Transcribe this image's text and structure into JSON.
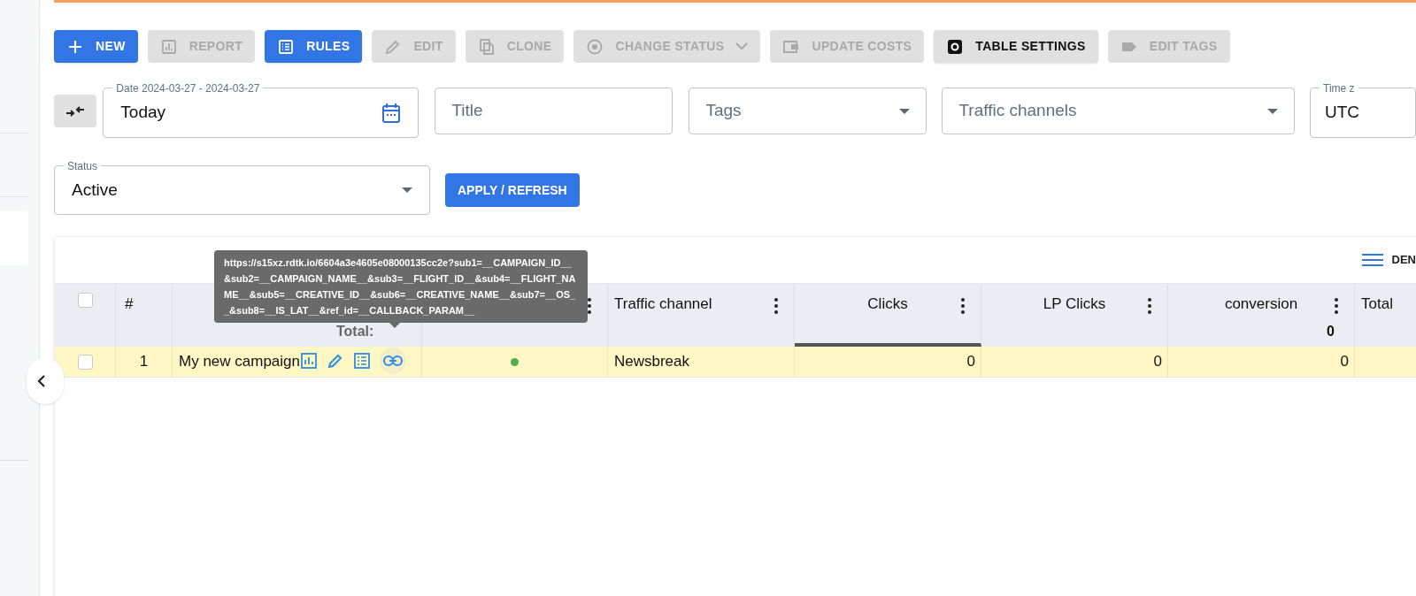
{
  "toolbar": [
    {
      "label": "NEW",
      "kind": "primary",
      "disabled": false
    },
    {
      "label": "REPORT",
      "kind": "default",
      "disabled": true
    },
    {
      "label": "RULES",
      "kind": "primary",
      "disabled": false
    },
    {
      "label": "EDIT",
      "kind": "default",
      "disabled": true
    },
    {
      "label": "CLONE",
      "kind": "default",
      "disabled": true
    },
    {
      "label": "CHANGE STATUS",
      "kind": "dropdown",
      "disabled": true
    },
    {
      "label": "UPDATE COSTS",
      "kind": "default",
      "disabled": true
    },
    {
      "label": "TABLE SETTINGS",
      "kind": "default",
      "disabled": false
    },
    {
      "label": "EDIT TAGS",
      "kind": "default",
      "disabled": true
    }
  ],
  "filters": {
    "date": {
      "label": "Date 2024-03-27 - 2024-03-27",
      "value": "Today"
    },
    "title": {
      "placeholder": "Title"
    },
    "tags": {
      "placeholder": "Tags"
    },
    "traffic_channels": {
      "placeholder": "Traffic channels"
    },
    "time_zone": {
      "label": "Time z",
      "value": "UTC"
    },
    "status": {
      "label": "Status",
      "value": "Active"
    },
    "apply_button": "APPLY / REFRESH"
  },
  "density_button": "DEN",
  "table": {
    "all_checked": false,
    "columns": [
      {
        "label": "#",
        "sorted": false
      },
      {
        "sorted": false,
        "total": "Total:"
      },
      {
        "sorted": false
      },
      {
        "label": "Traffic channel",
        "sorted": false
      },
      {
        "label": "Clicks",
        "sorted": true
      },
      {
        "label": "LP Clicks",
        "sorted": false
      },
      {
        "label": "conversion",
        "sorted": false,
        "total": "0"
      },
      {
        "label": "Total",
        "sorted": false
      }
    ],
    "rows": [
      {
        "number": "1",
        "name": "My new campaign",
        "active": true,
        "traffic_channel": "Newsbreak",
        "clicks": "0",
        "lp_clicks": "0",
        "conversion": "0",
        "checked": false,
        "highlighted": true
      }
    ]
  },
  "tooltip": "https://s15xz.rdtk.io/6604a3e4605e08000135cc2e?sub1=__CAMPAIGN_ID__&sub2=__CAMPAIGN_NAME__&sub3=__FLIGHT_ID__&sub4=__FLIGHT_NAME__&sub5=__CREATIVE_ID__&sub6=__CREATIVE_NAME__&sub7=__OS__&sub8=__IS_LAT__&ref_id=__CALLBACK_PARAM__"
}
